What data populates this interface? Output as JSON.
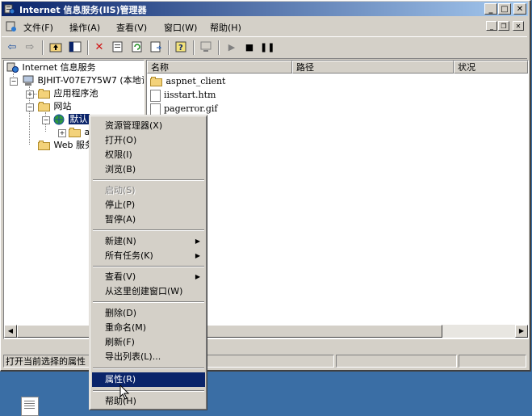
{
  "window": {
    "title": "Internet 信息服务(IIS)管理器"
  },
  "menubar": [
    {
      "label": "文件(F)"
    },
    {
      "label": "操作(A)"
    },
    {
      "label": "查看(V)"
    },
    {
      "label": "窗口(W)"
    },
    {
      "label": "帮助(H)"
    }
  ],
  "toolbar": {
    "icons": [
      "back-arrow-icon",
      "forward-arrow-icon",
      "up-folder-icon",
      "show-hide-tree-icon",
      "delete-icon",
      "properties-icon",
      "refresh-icon",
      "export-list-icon",
      "help-icon",
      "computer-icon",
      "start-icon",
      "stop-icon",
      "pause-icon"
    ]
  },
  "tree": {
    "root": "Internet 信息服务",
    "server": "BJHIT-V07E7Y5W7 (本地计",
    "app_pools": "应用程序池",
    "websites": "网站",
    "default_site": "默认",
    "child_folder": "a",
    "web_ext": "Web 服务"
  },
  "list": {
    "columns": [
      "名称",
      "路径",
      "状况"
    ],
    "rows": [
      {
        "name": "aspnet_client",
        "icon": "folder-icon"
      },
      {
        "name": "iisstart.htm",
        "icon": "file-icon"
      },
      {
        "name": "pagerror.gif",
        "icon": "file-icon"
      }
    ]
  },
  "status": {
    "text": "打开当前选择的属性"
  },
  "context_menu": {
    "items": [
      {
        "label": "资源管理器(X)",
        "state": "normal"
      },
      {
        "label": "打开(O)",
        "state": "normal"
      },
      {
        "label": "权限(I)",
        "state": "normal"
      },
      {
        "label": "浏览(B)",
        "state": "normal"
      },
      {
        "label": "启动(S)",
        "state": "disabled"
      },
      {
        "label": "停止(P)",
        "state": "normal"
      },
      {
        "label": "暂停(A)",
        "state": "normal"
      },
      {
        "label": "新建(N)",
        "state": "submenu"
      },
      {
        "label": "所有任务(K)",
        "state": "submenu"
      },
      {
        "label": "查看(V)",
        "state": "submenu"
      },
      {
        "label": "从这里创建窗口(W)",
        "state": "normal"
      },
      {
        "label": "删除(D)",
        "state": "normal"
      },
      {
        "label": "重命名(M)",
        "state": "normal"
      },
      {
        "label": "刷新(F)",
        "state": "normal"
      },
      {
        "label": "导出列表(L)...",
        "state": "normal"
      },
      {
        "label": "属性(R)",
        "state": "selected"
      },
      {
        "label": "帮助(H)",
        "state": "normal"
      }
    ]
  },
  "colors": {
    "title_start": "#0a246a",
    "title_end": "#a6caf0",
    "desktop": "#3a6ea5",
    "selection": "#0a246a"
  }
}
